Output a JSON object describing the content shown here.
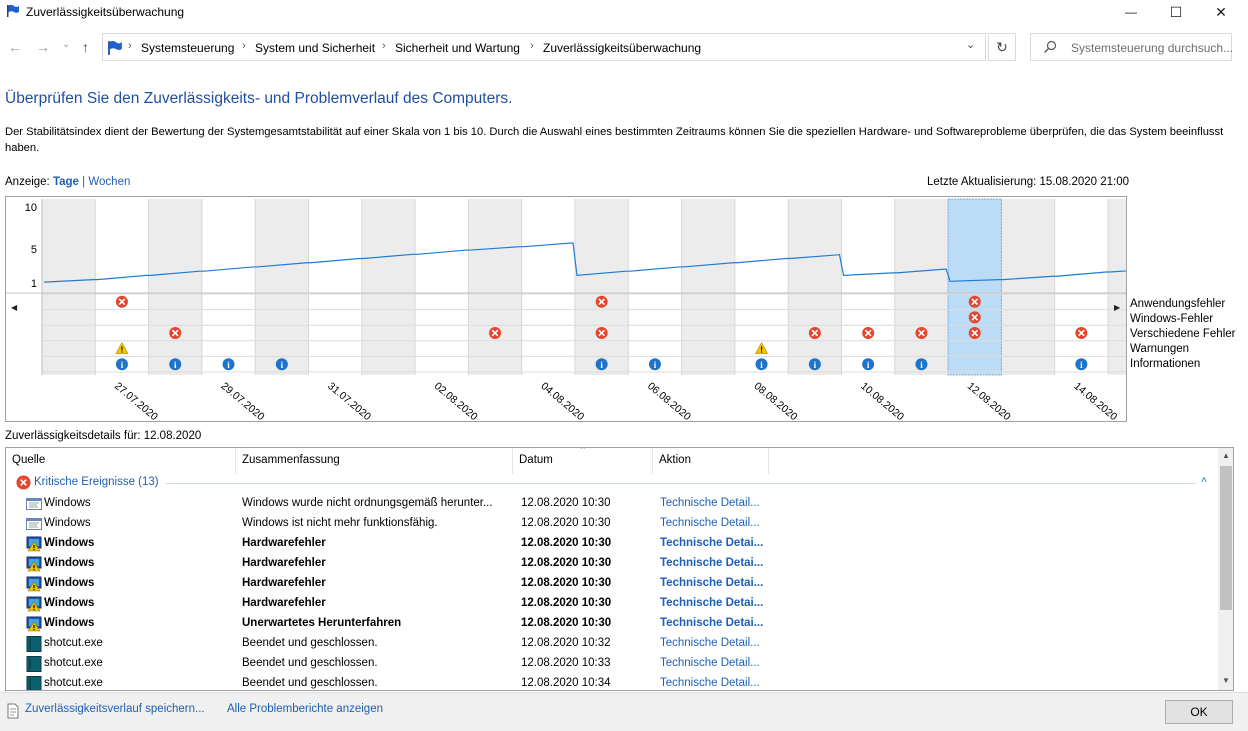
{
  "window": {
    "title": "Zuverlässigkeitsüberwachung",
    "minimize": "—",
    "maximize": "☐",
    "close": "✕"
  },
  "nav": {
    "back": "←",
    "forward": "→",
    "recent": "⌄",
    "up": "↑",
    "breadcrumb": [
      "Systemsteuerung",
      "System und Sicherheit",
      "Sicherheit und Wartung",
      "Zuverlässigkeitsüberwachung"
    ],
    "separator": "›",
    "dropdown": "⌄",
    "refresh": "↻",
    "search_placeholder": "Systemsteuerung durchsuch..."
  },
  "heading": "Überprüfen Sie den Zuverlässigkeits- und Problemverlauf des Computers.",
  "description": "Der Stabilitätsindex dient der Bewertung der Systemgesamtstabilität auf einer Skala von 1 bis 10. Durch die Auswahl eines bestimmten Zeitraums können Sie die speziellen Hardware- und Softwareprobleme überprüfen, die das System beeinflusst haben.",
  "view": {
    "label": "Anzeige:",
    "days": "Tage",
    "separator": "|",
    "weeks": "Wochen",
    "selected": "Tage"
  },
  "last_update": "Letzte Aktualisierung: 15.08.2020 21:00",
  "chart_data": {
    "type": "line",
    "y_ticks": [
      "10",
      "5",
      "1"
    ],
    "ylim": [
      1,
      10
    ],
    "x_tick_labels": [
      "27.07.2020",
      "29.07.2020",
      "31.07.2020",
      "02.08.2020",
      "04.08.2020",
      "06.08.2020",
      "08.08.2020",
      "10.08.2020",
      "12.08.2020",
      "14.08.2020"
    ],
    "days": [
      "26.07.2020",
      "27.07.2020",
      "28.07.2020",
      "29.07.2020",
      "30.07.2020",
      "31.07.2020",
      "01.08.2020",
      "02.08.2020",
      "03.08.2020",
      "04.08.2020",
      "05.08.2020",
      "06.08.2020",
      "07.08.2020",
      "08.08.2020",
      "09.08.2020",
      "10.08.2020",
      "11.08.2020",
      "12.08.2020",
      "13.08.2020",
      "14.08.2020",
      "15.08.2020"
    ],
    "stability_index": [
      1.1,
      1.4,
      1.9,
      2.4,
      2.9,
      3.4,
      3.9,
      4.4,
      4.9,
      5.3,
      1.9,
      2.4,
      2.9,
      3.4,
      3.9,
      1.9,
      2.2,
      1.2,
      1.4,
      1.8,
      2.3
    ],
    "selected_day": "12.08.2020",
    "rows": [
      "Anwendungsfehler",
      "Windows-Fehler",
      "Verschiedene Fehler",
      "Warnungen",
      "Informationen"
    ],
    "events": {
      "Anwendungsfehler": [
        "27.07.2020",
        "05.08.2020",
        "12.08.2020"
      ],
      "Windows-Fehler": [
        "12.08.2020"
      ],
      "Verschiedene Fehler": [
        "28.07.2020",
        "03.08.2020",
        "05.08.2020",
        "09.08.2020",
        "10.08.2020",
        "11.08.2020",
        "12.08.2020",
        "14.08.2020"
      ],
      "Warnungen": [
        "27.07.2020",
        "08.08.2020"
      ],
      "Informationen": [
        "27.07.2020",
        "28.07.2020",
        "29.07.2020",
        "30.07.2020",
        "05.08.2020",
        "06.08.2020",
        "08.08.2020",
        "09.08.2020",
        "10.08.2020",
        "11.08.2020",
        "14.08.2020",
        "15.08.2020"
      ]
    },
    "colors": {
      "line": "#1e7bd6",
      "shade": "#ececec",
      "selected": "#bcdcf6",
      "error": "#e3462e",
      "warning": "#f3c400",
      "info": "#1f73c8"
    }
  },
  "details": {
    "title": "Zuverlässigkeitsdetails für: 12.08.2020",
    "columns": [
      "Quelle",
      "Zusammenfassung",
      "Datum",
      "Aktion"
    ],
    "sort_caret": "^",
    "group_label": "Kritische Ereignisse (13)",
    "group_chevron": "˄",
    "rows": [
      {
        "source": "Windows",
        "summary": "Windows wurde nicht ordnungsgemäß herunter...",
        "date": "12.08.2020 10:30",
        "action": "Technische Detail...",
        "bold": false,
        "icon": "window-icon"
      },
      {
        "source": "Windows",
        "summary": "Windows ist nicht mehr funktionsfähig.",
        "date": "12.08.2020 10:30",
        "action": "Technische Detail...",
        "bold": false,
        "icon": "window-icon"
      },
      {
        "source": "Windows",
        "summary": "Hardwarefehler",
        "date": "12.08.2020 10:30",
        "action": "Technische Detai...",
        "bold": true,
        "icon": "hardware-icon"
      },
      {
        "source": "Windows",
        "summary": "Hardwarefehler",
        "date": "12.08.2020 10:30",
        "action": "Technische Detai...",
        "bold": true,
        "icon": "hardware-icon"
      },
      {
        "source": "Windows",
        "summary": "Hardwarefehler",
        "date": "12.08.2020 10:30",
        "action": "Technische Detai...",
        "bold": true,
        "icon": "hardware-icon"
      },
      {
        "source": "Windows",
        "summary": "Hardwarefehler",
        "date": "12.08.2020 10:30",
        "action": "Technische Detai...",
        "bold": true,
        "icon": "hardware-icon"
      },
      {
        "source": "Windows",
        "summary": "Unerwartetes Herunterfahren",
        "date": "12.08.2020 10:30",
        "action": "Technische Detai...",
        "bold": true,
        "icon": "hardware-icon"
      },
      {
        "source": "shotcut.exe",
        "summary": "Beendet und geschlossen.",
        "date": "12.08.2020 10:32",
        "action": "Technische Detail...",
        "bold": false,
        "icon": "app-icon"
      },
      {
        "source": "shotcut.exe",
        "summary": "Beendet und geschlossen.",
        "date": "12.08.2020 10:33",
        "action": "Technische Detail...",
        "bold": false,
        "icon": "app-icon"
      },
      {
        "source": "shotcut.exe",
        "summary": "Beendet und geschlossen.",
        "date": "12.08.2020 10:34",
        "action": "Technische Detail...",
        "bold": false,
        "icon": "app-icon"
      }
    ],
    "scroll_up": "▲",
    "scroll_down": "▼"
  },
  "footer": {
    "save_link": "Zuverlässigkeitsverlauf speichern...",
    "reports_link": "Alle Problemberichte anzeigen",
    "ok": "OK"
  }
}
